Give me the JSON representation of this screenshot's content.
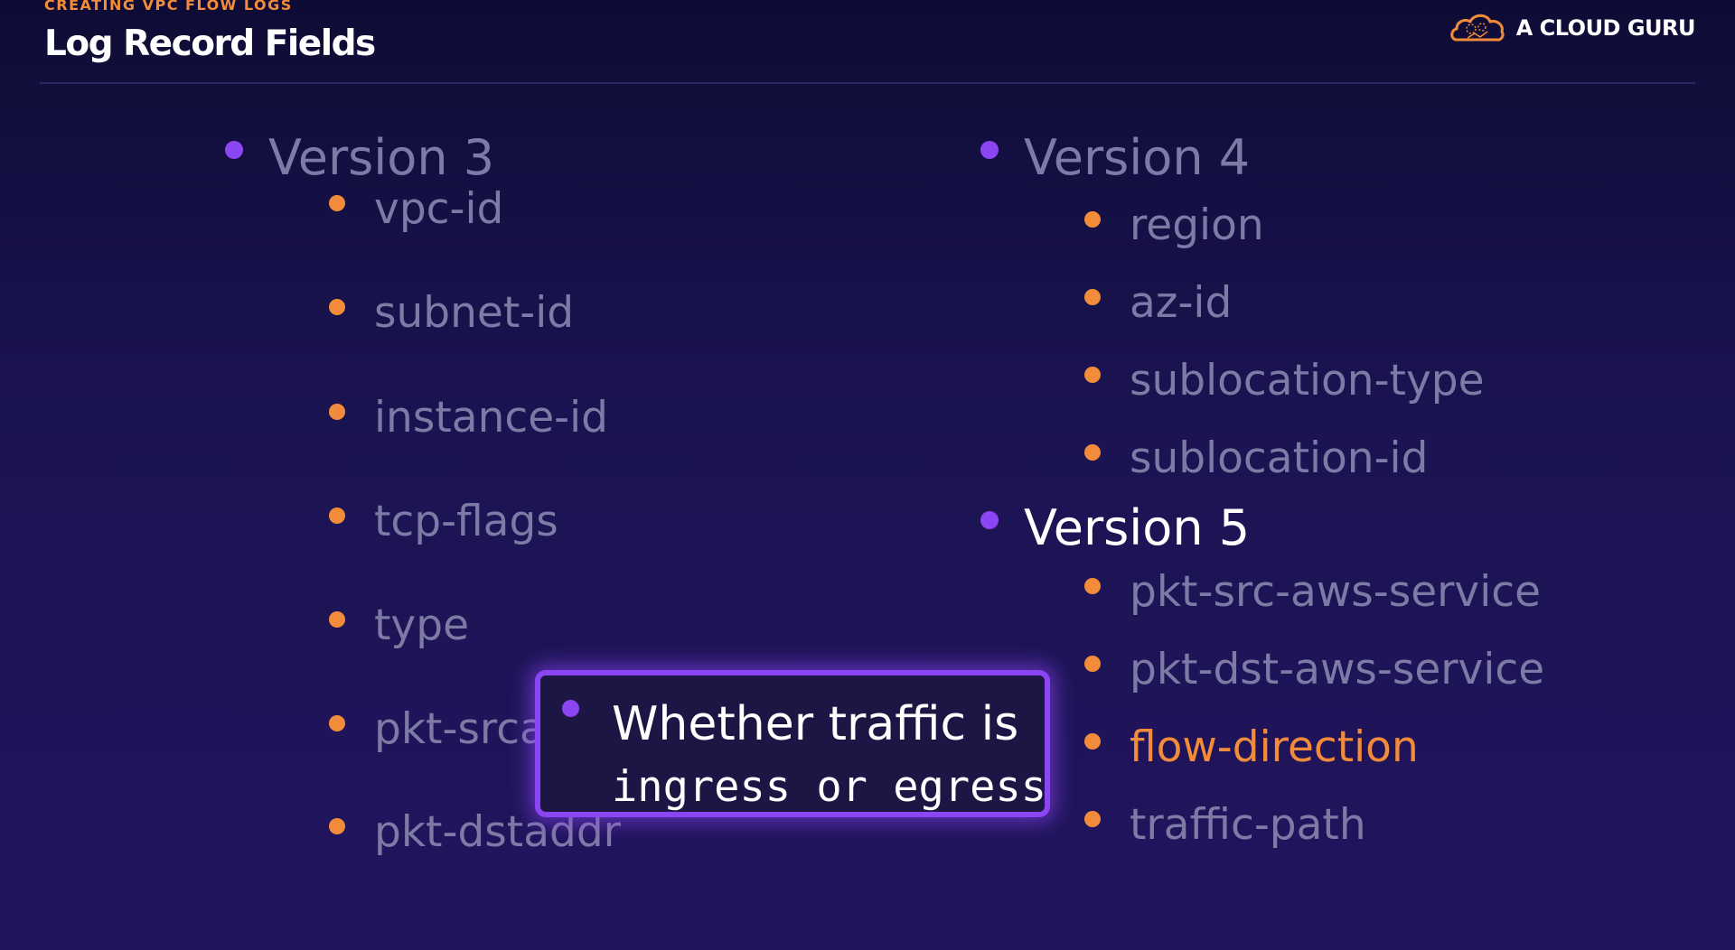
{
  "header": {
    "section_label": "CREATING VPC FLOW LOGS",
    "title": "Log Record Fields",
    "brand": {
      "name": "A CLOUD GURU",
      "icon": "cloud-logo-icon",
      "color": "#f28c3a"
    }
  },
  "colors": {
    "background": "#1a1350",
    "accent_orange": "#f28c3a",
    "accent_purple": "#8b45f2",
    "dim_text": "#7e7aa6"
  },
  "left_column": {
    "heading": "Version 3",
    "fields": [
      "vpc-id",
      "subnet-id",
      "instance-id",
      "tcp-flags",
      "type",
      "pkt-srcaddr",
      "pkt-dstaddr"
    ]
  },
  "right_column": {
    "v4": {
      "heading": "Version 4",
      "fields": [
        "region",
        "az-id",
        "sublocation-type",
        "sublocation-id"
      ]
    },
    "v5": {
      "heading": "Version 5",
      "fields": [
        "pkt-src-aws-service",
        "pkt-dst-aws-service",
        "flow-direction",
        "traffic-path"
      ],
      "highlighted_field": "flow-direction"
    }
  },
  "tooltip": {
    "line1": "Whether traffic is",
    "line2": "ingress or egress"
  }
}
